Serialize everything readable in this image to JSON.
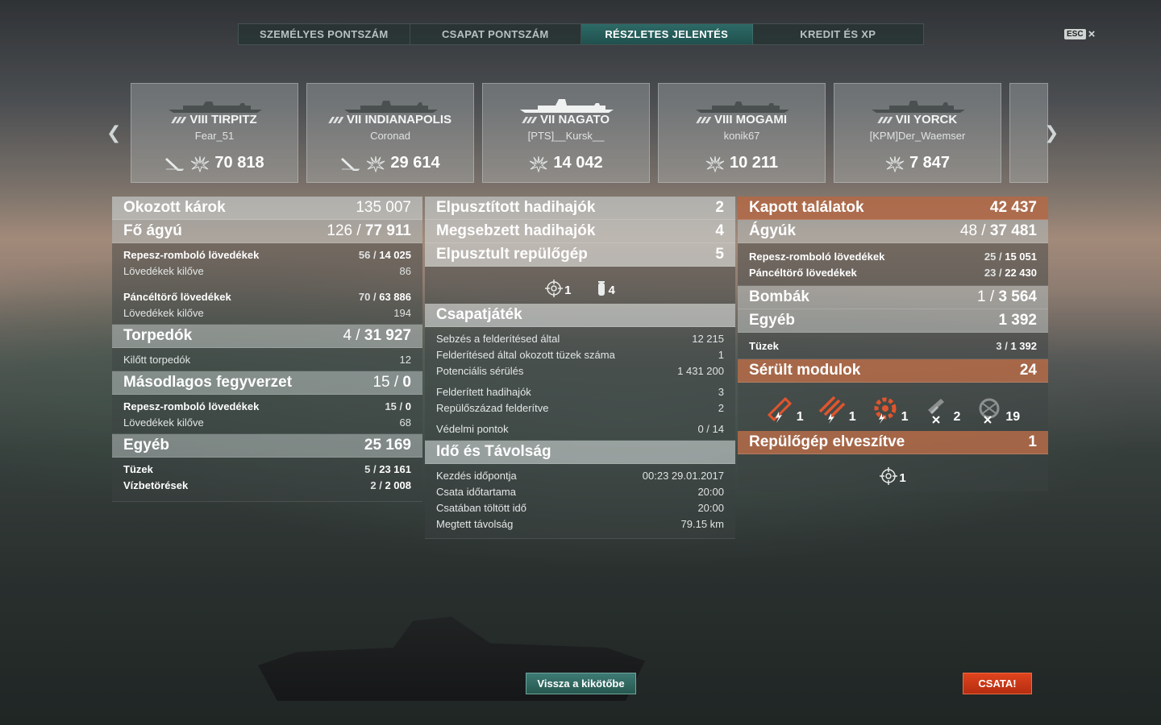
{
  "tabs": [
    {
      "label": "SZEMÉLYES PONTSZÁM",
      "active": false
    },
    {
      "label": "CSAPAT PONTSZÁM",
      "active": false
    },
    {
      "label": "RÉSZLETES JELENTÉS",
      "active": true
    },
    {
      "label": "KREDIT ÉS XP",
      "active": false
    }
  ],
  "esc": {
    "key": "ESC",
    "close": "×"
  },
  "ships": [
    {
      "name": "VIII TIRPITZ",
      "player": "Fear_51",
      "score": "70 818",
      "torpedo_icon": true
    },
    {
      "name": "VII INDIANAPOLIS",
      "player": "Coronad",
      "score": "29 614",
      "torpedo_icon": true
    },
    {
      "name": "VII NAGATO",
      "player": "[PTS]__Kursk__",
      "score": "14 042",
      "torpedo_icon": false
    },
    {
      "name": "VIII MOGAMI",
      "player": "konik67",
      "score": "10 211",
      "torpedo_icon": false
    },
    {
      "name": "VII YORCK",
      "player": "[KPM]Der_Waemser",
      "score": "7 847",
      "torpedo_icon": false
    }
  ],
  "left": {
    "damage": {
      "label": "Okozott károk",
      "value": "135 007"
    },
    "main": {
      "label": "Fő ágyú",
      "hits": "126",
      "dmg": "77 911"
    },
    "he": {
      "label": "Repesz-romboló lövedékek",
      "hits": "56",
      "dmg": "14 025",
      "fired_label": "Lövedékek kilőve",
      "fired": "86"
    },
    "ap": {
      "label": "Páncéltörő lövedékek",
      "hits": "70",
      "dmg": "63 886",
      "fired_label": "Lövedékek kilőve",
      "fired": "194"
    },
    "torp": {
      "label": "Torpedók",
      "hits": "4",
      "dmg": "31 927",
      "fired_label": "Kilőtt torpedók",
      "fired": "12"
    },
    "secondary": {
      "label": "Másodlagos fegyverzet",
      "hits": "15",
      "dmg": "0"
    },
    "sec_he": {
      "label": "Repesz-romboló lövedékek",
      "hits": "15",
      "dmg": "0",
      "fired_label": "Lövedékek kilőve",
      "fired": "68"
    },
    "other": {
      "label": "Egyéb",
      "value": "25 169"
    },
    "fires": {
      "label": "Tüzek",
      "hits": "5",
      "dmg": "23 161"
    },
    "floods": {
      "label": "Vízbetörések",
      "hits": "2",
      "dmg": "2 008"
    }
  },
  "middle": {
    "destroyed": {
      "label": "Elpusztított hadihajók",
      "value": "2"
    },
    "damaged": {
      "label": "Megsebzett hadihajók",
      "value": "4"
    },
    "planes": {
      "label": "Elpusztult repülőgép",
      "value": "5"
    },
    "planes_fighter": "1",
    "planes_aa": "4",
    "team": {
      "label": "Csapatjáték"
    },
    "spot_dmg": {
      "label": "Sebzés a felderítésed által",
      "value": "12 215"
    },
    "spot_fires": {
      "label": "Felderítésed által okozott tüzek száma",
      "value": "1"
    },
    "potential": {
      "label": "Potenciális sérülés",
      "value": "1 431 200"
    },
    "spotted_ships": {
      "label": "Felderített hadihajók",
      "value": "3"
    },
    "spotted_squads": {
      "label": "Repülőszázad felderítve",
      "value": "2"
    },
    "defense": {
      "label": "Védelmi pontok",
      "value": "0 / 14"
    },
    "time": {
      "label": "Idő és Távolság"
    },
    "start": {
      "label": "Kezdés időpontja",
      "value": "00:23  29.01.2017"
    },
    "duration": {
      "label": "Csata időtartama",
      "value": "20:00"
    },
    "time_in": {
      "label": "Csatában töltött idő",
      "value": "20:00"
    },
    "distance": {
      "label": "Megtett távolság",
      "value": "79.15 km"
    }
  },
  "right": {
    "received": {
      "label": "Kapott találatok",
      "value": "42 437"
    },
    "guns": {
      "label": "Ágyúk",
      "hits": "48",
      "dmg": "37 481"
    },
    "he": {
      "label": "Repesz-romboló lövedékek",
      "hits": "25",
      "dmg": "15 051"
    },
    "ap": {
      "label": "Páncéltörő lövedékek",
      "hits": "23",
      "dmg": "22 430"
    },
    "bombs": {
      "label": "Bombák",
      "hits": "1",
      "dmg": "3 564"
    },
    "other": {
      "label": "Egyéb",
      "value": "1 392"
    },
    "fires": {
      "label": "Tüzek",
      "hits": "3",
      "dmg": "1 392"
    },
    "modules": {
      "label": "Sérült modulok",
      "value": "24"
    },
    "module_counts": [
      "1",
      "1",
      "1",
      "2",
      "19"
    ],
    "planes_lost": {
      "label": "Repülőgép elveszítve",
      "value": "1"
    },
    "planes_lost_icon_count": "1"
  },
  "buttons": {
    "port": "Vissza a kikötőbe",
    "battle": "CSATA!"
  },
  "colors": {
    "accent_teal": "#2d6a67",
    "orange": "#b26a48",
    "battle": "#d23a18"
  }
}
